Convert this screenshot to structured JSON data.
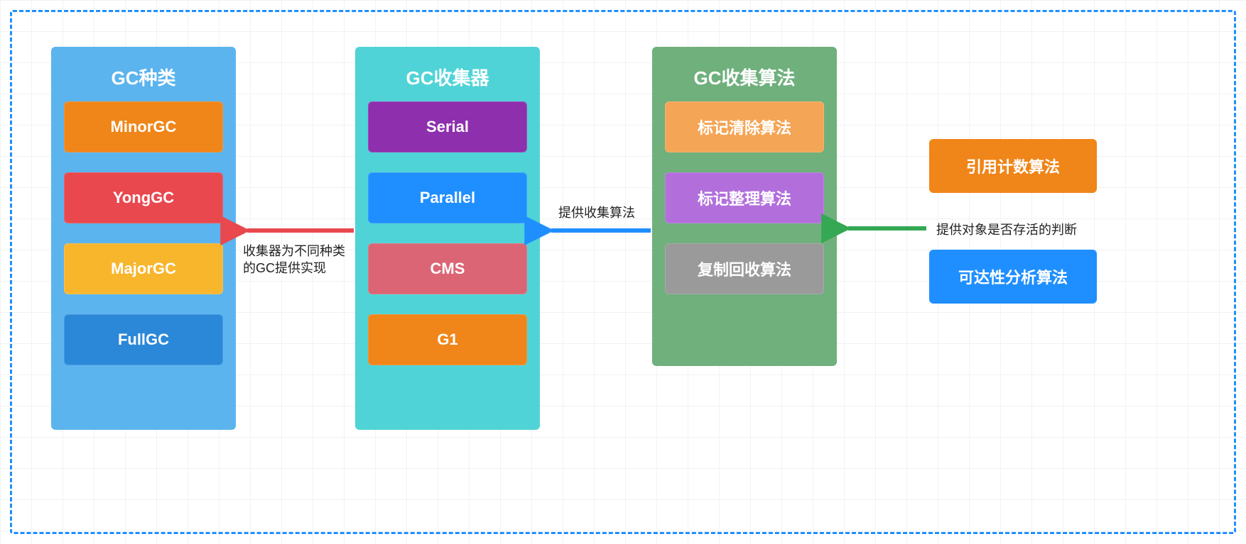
{
  "panels": {
    "types": {
      "title": "GC种类",
      "items": [
        "MinorGC",
        "YongGC",
        "MajorGC",
        "FullGC"
      ]
    },
    "collectors": {
      "title": "GC收集器",
      "items": [
        "Serial",
        "Parallel",
        "CMS",
        "G1"
      ]
    },
    "algorithms": {
      "title": "GC收集算法",
      "items": [
        "标记清除算法",
        "标记整理算法",
        "复制回收算法"
      ]
    }
  },
  "right": {
    "box1": "引用计数算法",
    "box2": "可达性分析算法"
  },
  "arrows": {
    "a1_label_line1": "收集器为不同种类",
    "a1_label_line2": "的GC提供实现",
    "a2_label": "提供收集算法",
    "a3_label": "提供对象是否存活的判断"
  },
  "colors": {
    "dashed_border": "#1f8fff",
    "arrow_red": "#e9484f",
    "arrow_blue": "#1f8fff",
    "arrow_green": "#34a853"
  }
}
